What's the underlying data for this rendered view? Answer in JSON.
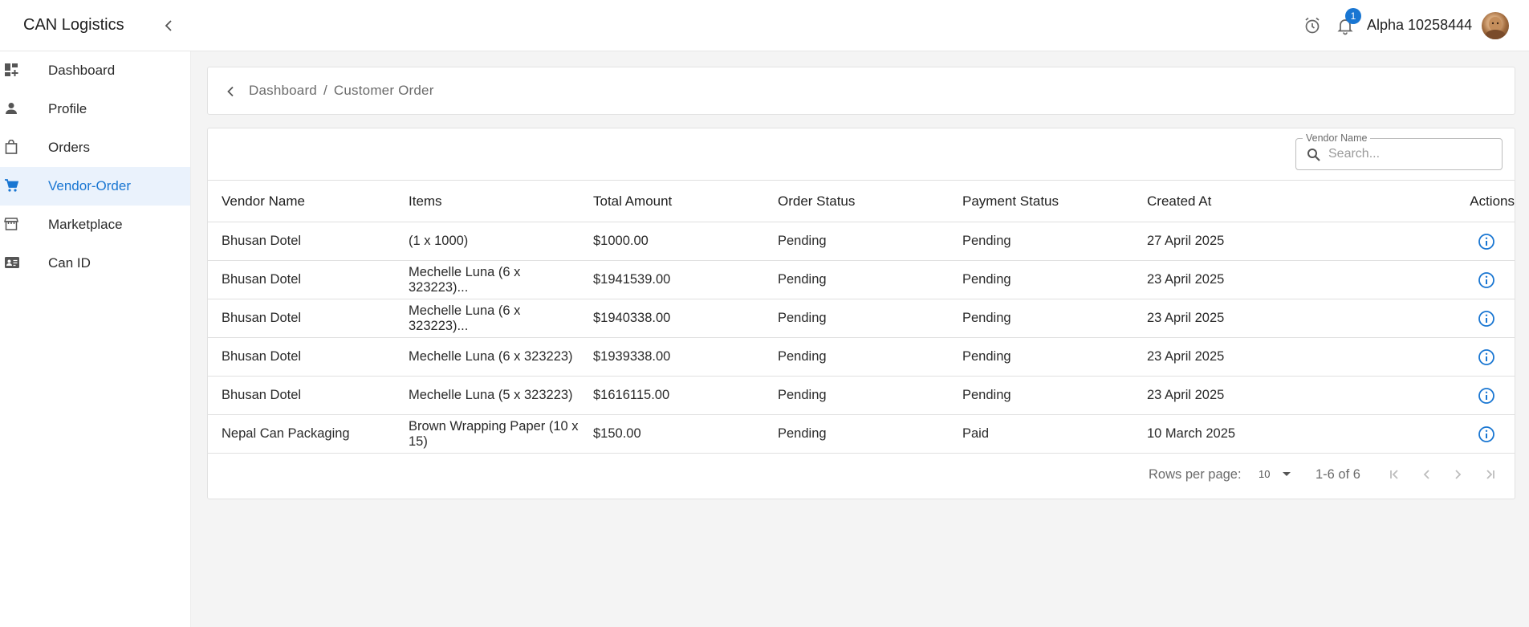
{
  "app": {
    "brand": "CAN Logistics",
    "user_name": "Alpha 10258444",
    "notification_count": "1"
  },
  "sidebar": {
    "items": [
      {
        "label": "Dashboard",
        "icon": "dashboard-icon"
      },
      {
        "label": "Profile",
        "icon": "person-icon"
      },
      {
        "label": "Orders",
        "icon": "shopping-bag-icon"
      },
      {
        "label": "Vendor-Order",
        "icon": "cart-icon",
        "active": true
      },
      {
        "label": "Marketplace",
        "icon": "store-icon"
      },
      {
        "label": "Can ID",
        "icon": "id-card-icon"
      }
    ]
  },
  "breadcrumb": {
    "parent": "Dashboard",
    "separator": "/",
    "current": "Customer Order"
  },
  "search": {
    "legend": "Vendor Name",
    "placeholder": "Search..."
  },
  "table": {
    "headers": [
      "Vendor Name",
      "Items",
      "Total Amount",
      "Order Status",
      "Payment Status",
      "Created At",
      "Actions"
    ],
    "rows": [
      {
        "vendor": "Bhusan Dotel",
        "items": "(1 x 1000)",
        "total": "$1000.00",
        "order_status": "Pending",
        "payment_status": "Pending",
        "created": "27 April 2025"
      },
      {
        "vendor": "Bhusan Dotel",
        "items": "Mechelle Luna (6 x 323223)...",
        "total": "$1941539.00",
        "order_status": "Pending",
        "payment_status": "Pending",
        "created": "23 April 2025"
      },
      {
        "vendor": "Bhusan Dotel",
        "items": "Mechelle Luna (6 x 323223)...",
        "total": "$1940338.00",
        "order_status": "Pending",
        "payment_status": "Pending",
        "created": "23 April 2025"
      },
      {
        "vendor": "Bhusan Dotel",
        "items": "Mechelle Luna (6 x 323223)",
        "total": "$1939338.00",
        "order_status": "Pending",
        "payment_status": "Pending",
        "created": "23 April 2025"
      },
      {
        "vendor": "Bhusan Dotel",
        "items": "Mechelle Luna (5 x 323223)",
        "total": "$1616115.00",
        "order_status": "Pending",
        "payment_status": "Pending",
        "created": "23 April 2025"
      },
      {
        "vendor": "Nepal Can Packaging",
        "items": "Brown Wrapping Paper (10 x 15)",
        "total": "$150.00",
        "order_status": "Pending",
        "payment_status": "Paid",
        "created": "10 March 2025"
      }
    ]
  },
  "pagination": {
    "rows_per_page_label": "Rows per page:",
    "rows_per_page_value": "10",
    "range": "1-6 of 6"
  },
  "colors": {
    "accent": "#1976d2",
    "active_bg": "#eaf2fc",
    "page_bg": "#f4f4f4"
  }
}
